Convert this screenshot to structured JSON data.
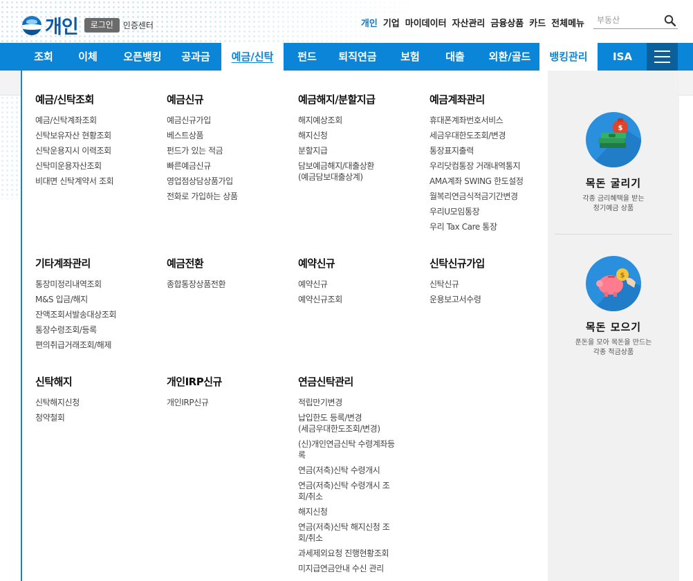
{
  "header": {
    "brand_title": "개인",
    "login_label": "로그인",
    "cert_label": "인증센터",
    "top_links": [
      "개인",
      "기업",
      "마이데이터",
      "자산관리",
      "금융상품",
      "카드",
      "전체메뉴"
    ],
    "top_links_active_index": 0,
    "search": {
      "placeholder": "부동산",
      "value": ""
    }
  },
  "nav": {
    "items": [
      "조회",
      "이체",
      "오픈뱅킹",
      "공과금",
      "예금/신탁",
      "펀드",
      "퇴직연금",
      "보험",
      "대출",
      "외환/골드",
      "뱅킹관리",
      "ISA"
    ],
    "active_index": 4,
    "highlight_index": 10,
    "menu_icon": "hamburger-icon"
  },
  "mega_menu": {
    "categories": [
      {
        "title": "예금/신탁조회",
        "items": [
          "예금/신탁계좌조회",
          "신탁보유자산 현황조회",
          "신탁운용지시 이력조회",
          "신탁미운용자산조회",
          "비대면 신탁계약서 조회"
        ]
      },
      {
        "title": "예금신규",
        "items": [
          "예금신규가입",
          "베스트상품",
          "펀드가 있는 적금",
          "빠른예금신규",
          "영업점상담상품가입",
          "전화로 가입하는 상품"
        ]
      },
      {
        "title": "예금해지/분할지급",
        "items": [
          "해지예상조회",
          "해지신청",
          "분할지급",
          "담보예금해지/대출상환\n(예금담보대출상계)"
        ]
      },
      {
        "title": "예금계좌관리",
        "items": [
          "휴대폰계좌번호서비스",
          "세금우대한도조회/변경",
          "통장표지출력",
          "우리닷컴통장 거래내역통지",
          "AMA계좌 SWING 한도설정",
          "월복리연금식적금기간변경",
          "우리U모임통장",
          "우리 Tax Care 통장"
        ]
      },
      {
        "title": "기타계좌관리",
        "items": [
          "통장미정리내역조회",
          "M&S 입금/해지",
          "잔액조회서발송대상조회",
          "통장수령조회/등록",
          "편의취급거래조회/해제"
        ]
      },
      {
        "title": "예금전환",
        "items": [
          "종합통장상품전환"
        ]
      },
      {
        "title": "예약신규",
        "items": [
          "예약신규",
          "예약신규조회"
        ]
      },
      {
        "title": "신탁신규가입",
        "items": [
          "신탁신규",
          "운용보고서수령"
        ]
      },
      {
        "title": "신탁해지",
        "items": [
          "신탁해지신청",
          "청약철회"
        ]
      },
      {
        "title": "개인IRP신규",
        "items": [
          "개인IRP신규"
        ]
      },
      {
        "title": "연금신탁관리",
        "items": [
          "적립만기변경",
          "납입한도 등록/변경\n(세금우대한도조회/변경)",
          "(신)개인연금신탁 수령계좌등\n록",
          "연금(저축)신탁 수령개시",
          "연금(저축)신탁 수령개시 조\n회/취소",
          "해지신청",
          "연금(저축)신탁 해지신청 조\n회/취소",
          "과세제외요청 진행현황조회",
          "미지급연금안내 수신 관리"
        ]
      }
    ]
  },
  "promo": [
    {
      "title": "목돈 굴리기",
      "desc_line1": "각종 금리혜택을 받는",
      "desc_line2": "정기예금 상품",
      "icon": "money-bag-icon"
    },
    {
      "title": "목돈 모으기",
      "desc_line1": "푼돈을 모아 목돈을 만드는",
      "desc_line2": "각종 적금상품",
      "icon": "piggy-bank-icon"
    }
  ],
  "colors": {
    "primary": "#0b85d8",
    "menu_button": "#0b5f9b",
    "brand": "#0d5aa7",
    "promo_bg": "#f1f1f1"
  }
}
